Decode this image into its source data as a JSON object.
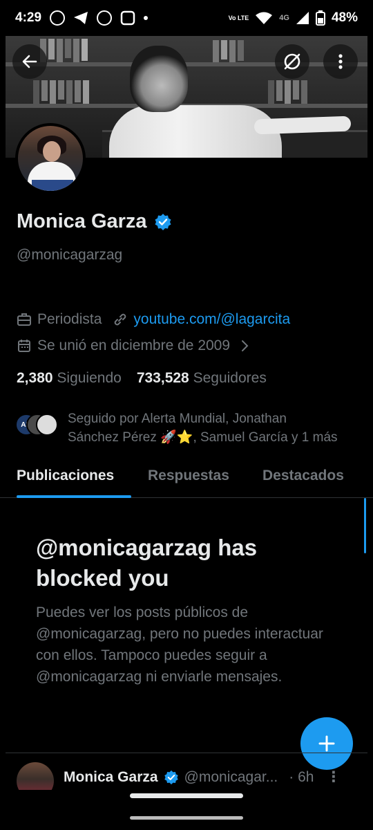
{
  "status_bar": {
    "time": "4:29",
    "battery": "48%",
    "network_badge": "Vo LTE",
    "network_type": "4G"
  },
  "header": {
    "back_icon": "arrow-left-icon",
    "refresh_icon": "slashed-circle-icon",
    "more_icon": "vertical-dots-icon"
  },
  "profile": {
    "name": "Monica Garza",
    "handle": "@monicagarzag",
    "occupation": "Periodista",
    "link": "youtube.com/@lagarcita",
    "joined": "Se unió en diciembre de 2009",
    "following_count": "2,380",
    "following_label": "Siguiendo",
    "followers_count": "733,528",
    "followers_label": "Seguidores",
    "followed_by_line1": "Seguido por Alerta Mundial, Jonathan",
    "followed_by_line2": "Sánchez Pérez 🚀⭐, Samuel García y 1 más",
    "followed_by_avatar_1": "AM"
  },
  "tabs": [
    {
      "label": "Publicaciones",
      "active": true
    },
    {
      "label": "Respuestas",
      "active": false
    },
    {
      "label": "Destacados",
      "active": false
    }
  ],
  "blocked": {
    "title": "@monicagarzag has blocked you",
    "body": "Puedes ver los posts públicos de @monicagarzag, pero no puedes interactuar con ellos. Tampoco puedes seguir a @monicagarzag ni enviarle mensajes."
  },
  "post": {
    "name": "Monica Garza",
    "handle": "@monicagar...",
    "time": "· 6h",
    "more": "⋮"
  },
  "colors": {
    "accent": "#1d9bf0",
    "background": "#000000",
    "text_primary": "#e7e9ea",
    "text_secondary": "#71767b"
  }
}
